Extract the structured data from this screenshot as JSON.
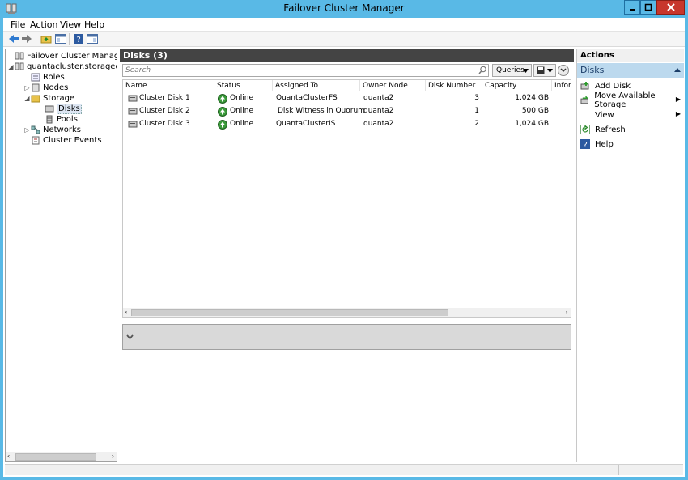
{
  "window": {
    "title": "Failover Cluster Manager"
  },
  "menu": {
    "file": "File",
    "action": "Action",
    "view": "View",
    "help": "Help"
  },
  "tree": {
    "root": "Failover Cluster Manager",
    "cluster": "quantacluster.storagedoma",
    "roles": "Roles",
    "nodes": "Nodes",
    "storage": "Storage",
    "disks": "Disks",
    "pools": "Pools",
    "networks": "Networks",
    "events": "Cluster Events"
  },
  "center": {
    "header": "Disks (3)",
    "search_placeholder": "Search",
    "queries_label": "Queries",
    "columns": [
      "Name",
      "Status",
      "Assigned To",
      "Owner Node",
      "Disk Number",
      "Capacity",
      "Informa"
    ],
    "rows": [
      {
        "name": "Cluster Disk 1",
        "status": "Online",
        "assigned": "QuantaClusterFS",
        "owner": "quanta2",
        "number": "3",
        "capacity": "1,024 GB"
      },
      {
        "name": "Cluster Disk 2",
        "status": "Online",
        "assigned": "Disk Witness in Quorum",
        "owner": "quanta2",
        "number": "1",
        "capacity": "500 GB"
      },
      {
        "name": "Cluster Disk 3",
        "status": "Online",
        "assigned": "QuantaClusterIS",
        "owner": "quanta2",
        "number": "2",
        "capacity": "1,024 GB"
      }
    ]
  },
  "actions": {
    "title": "Actions",
    "group": "Disks",
    "items": [
      "Add Disk",
      "Move Available Storage",
      "View",
      "Refresh",
      "Help"
    ]
  },
  "colors": {
    "title_bar": "#59b9e6",
    "header_dark": "#444444",
    "close": "#c7362c",
    "selected_group": "#bcd9ee"
  }
}
